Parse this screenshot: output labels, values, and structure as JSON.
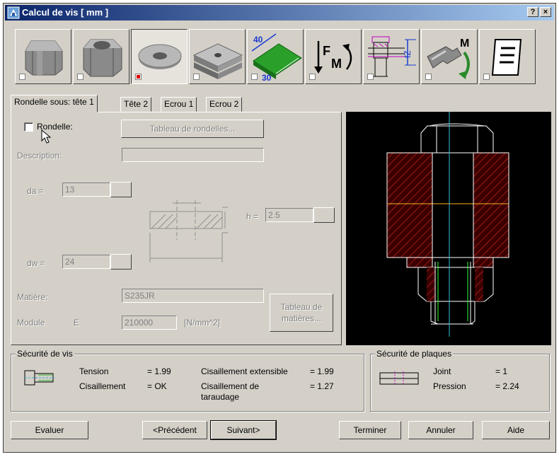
{
  "window": {
    "title": "Calcul de vis [ mm ]",
    "help_button": "?",
    "close_button": "×"
  },
  "toolbar": {
    "items": [
      {
        "name": "bolt-head",
        "checked": false
      },
      {
        "name": "nut",
        "checked": false
      },
      {
        "name": "washer",
        "checked": true,
        "active": true
      },
      {
        "name": "plates",
        "checked": false
      },
      {
        "name": "plate-dimensions",
        "checked": false,
        "text_top": "40",
        "text_bottom": "30"
      },
      {
        "name": "force-moment",
        "checked": false,
        "text": "M"
      },
      {
        "name": "assembly-section",
        "checked": false
      },
      {
        "name": "wrench-torque",
        "checked": false,
        "text": "M"
      },
      {
        "name": "document",
        "checked": false
      }
    ]
  },
  "tabs": [
    "Rondelle sous: tête 1",
    "Tête 2",
    "Ecrou 1",
    "Ecrou 2"
  ],
  "washer": {
    "checkbox_label": "Rondelle:",
    "table_button": "Tableau de rondelles...",
    "description_label": "Description:",
    "description_value": "",
    "da_label": "da =",
    "da_value": "13",
    "h_label": "h =",
    "h_value": "2.5",
    "dw_label": "dw =",
    "dw_value": "24",
    "material_label": "Matière:",
    "material_value": "S235JR",
    "module_label": "Module",
    "module_symbol": "E",
    "module_value": "210000",
    "module_unit": "[N/mm^2]",
    "material_table_button": "Tableau de matières..."
  },
  "safety_screw": {
    "title": "Sécurité de vis",
    "rows": [
      {
        "label": "Tension",
        "value": "= 1.99",
        "label2": "Cisaillement extensible",
        "value2": "= 1.99"
      },
      {
        "label": "Cisaillement",
        "value": "= OK",
        "label2": "Cisaillement de taraudage",
        "value2": "= 1.27"
      }
    ]
  },
  "safety_plates": {
    "title": "Sécurité de plaques",
    "rows": [
      {
        "label": "Joint",
        "value": "= 1"
      },
      {
        "label": "Pression",
        "value": "= 2.24"
      }
    ]
  },
  "buttons": {
    "evaluate": "Evaluer",
    "previous": "<Précédent",
    "next": "Suivant>",
    "finish": "Terminer",
    "cancel": "Annuler",
    "help": "Aide"
  }
}
